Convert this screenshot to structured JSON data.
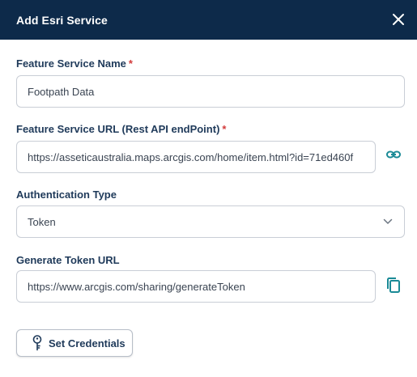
{
  "dialog": {
    "title": "Add Esri Service",
    "close_icon": "close-icon"
  },
  "feature_name": {
    "label": "Feature Service Name",
    "required_mark": "*",
    "value": "Footpath Data"
  },
  "feature_url": {
    "label": "Feature Service URL (Rest API endPoint)",
    "required_mark": "*",
    "value": "https://asseticaustralia.maps.arcgis.com/home/item.html?id=71ed460f",
    "action_icon": "link-icon"
  },
  "auth": {
    "label": "Authentication Type",
    "selected": "Token",
    "dropdown_icon": "chevron-down-icon"
  },
  "token_url": {
    "label": "Generate Token URL",
    "value": "https://www.arcgis.com/sharing/generateToken",
    "action_icon": "copy-icon"
  },
  "credentials_button": {
    "label": "Set Credentials",
    "icon": "key-icon"
  },
  "colors": {
    "header_bg": "#0d2a4a",
    "accent": "#1a8a96",
    "required": "#d23b3b"
  }
}
